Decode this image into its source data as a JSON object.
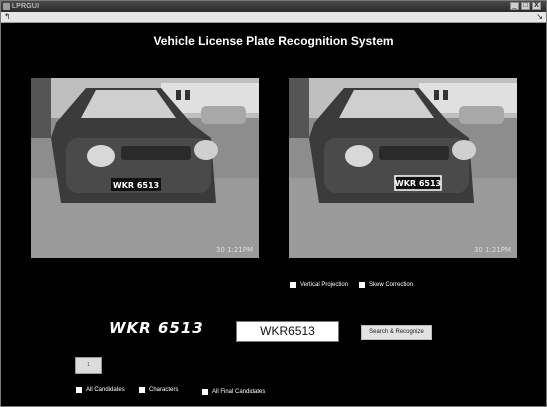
{
  "window": {
    "title": "LPRGUI",
    "menu_left": "↰",
    "menu_right": "↘",
    "btn_min": "_",
    "btn_max": "□",
    "btn_close": "X"
  },
  "app": {
    "title": "Vehicle License Plate Recognition System"
  },
  "images": {
    "left": {
      "plate_text": "WKR 6513",
      "timestamp": "30 1:21PM"
    },
    "right": {
      "plate_text": "WKR 6513",
      "timestamp": "30 1:21PM"
    }
  },
  "options": {
    "vertical_projection": "Vertical Projection",
    "skew_correction": "Skew Correction"
  },
  "result": {
    "plate_large": "WKR 6513",
    "recognized_text": "WKR6513",
    "search_button": "Search & Recognize",
    "small_button": "1"
  },
  "bottom_options": {
    "all_candidates": "All Candidates",
    "characters": "Characters",
    "all_final_candidates": "All Final Candidates"
  },
  "colors": {
    "background": "#000000",
    "text": "#ffffff",
    "button": "#e2e2e2"
  }
}
